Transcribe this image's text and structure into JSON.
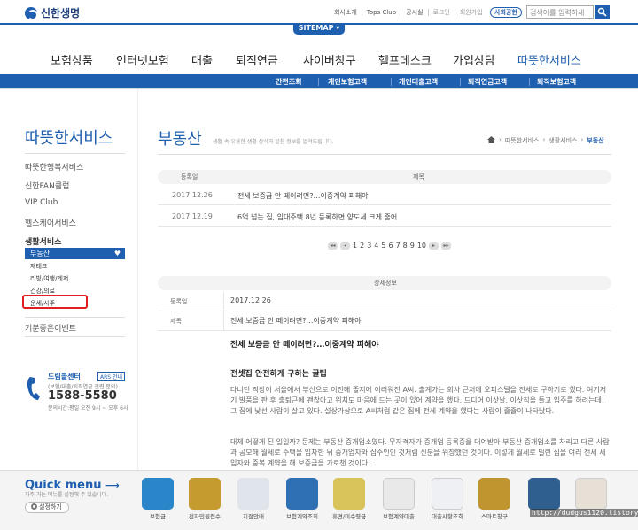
{
  "header": {
    "logo": "신한생명",
    "toplinks": [
      "회사소개",
      "Tops Club",
      "공시실",
      "로그인",
      "회원가입"
    ],
    "social_button": "사회공헌",
    "search_placeholder": "검색어를 입력하세",
    "sitemap": "SITEMAP ▾"
  },
  "gnb": [
    "보험상품",
    "인터넷보험",
    "대출",
    "퇴직연금",
    "사이버창구",
    "헬프데스크",
    "가입상담",
    "따뜻한서비스"
  ],
  "subnav": [
    "간편조회",
    "개인보험고객",
    "개인대출고객",
    "퇴직연금고객",
    "퇴직보험고객"
  ],
  "sidebar": {
    "title": "따뜻한서비스",
    "items": [
      "따뜻한행복서비스",
      "신한FAN클럽",
      "VIP Club",
      "헬스케어서비스"
    ],
    "group_label": "생활서비스",
    "active": "부동산",
    "sub_items": [
      "재테크",
      "리빙/여행/레저",
      "건강/의료",
      "운세/사주"
    ],
    "bottom_item": "기분좋은이벤트",
    "dream": {
      "title": "드림콜센터",
      "tag": "ARS 안내",
      "sub": "(보험/대출/퇴직연금 관련 문의)",
      "number": "1588-5580",
      "hours": "문의시간:평일 오전 9시 ~ 오후 6시"
    }
  },
  "page": {
    "title": "부동산",
    "desc": "생활 속 유용한 생활 상식과 알찬 정보를 알려드립니다.",
    "breadcrumb": [
      "따뜻한서비스",
      "생활서비스",
      "부동산"
    ]
  },
  "list": {
    "headers": [
      "등록일",
      "제목"
    ],
    "rows": [
      {
        "date": "2017.12.26",
        "subject": "전세 보증금 안 떼이려면?…이중계약 피해야"
      },
      {
        "date": "2017.12.19",
        "subject": "6억 넘는 집, 임대주택 8년 등록하면 양도세 크게 줄어"
      }
    ]
  },
  "pager": {
    "first": "◂◂",
    "prev": "◂",
    "pages": [
      "1",
      "2",
      "3",
      "4",
      "5",
      "6",
      "7",
      "8",
      "9",
      "10"
    ],
    "next": "▸",
    "last": "▸▸"
  },
  "detail": {
    "header": "상세정보",
    "date_label": "등록일",
    "date_value": "2017.12.26",
    "subject_label": "제목",
    "subject_value": "전세 보증금 안 떼이려면?…이중계약 피해야",
    "article_title": "전세 보증금 안 떼이려면?…이중계약 피해야",
    "article_sub": "전셋집 안전하게 구하는 꿀팁",
    "paragraphs": [
      "다니던 직장이 서울에서 부산으로 이전해 졸지에 이러워진 A씨. 출계가는 회사 근처에 오피스텔을 전세로 구하기로 했다. 여기저기 발품을 판 후 출퇴근에 괜찮아고 위치도 마음에 드는 곳이 있어 계약을 했다. 드디어 이삿날. 이삿짐을 들고 입주를 하려는데, 그 집에 낯선 사람이 살고 있다. 설상가상으로 A씨처럼 같은 집에 전세 계약을 했다는 사람이 줄줄이 나타났다.",
      "대체 어떻게 된 일일까? 문제는 부동산 중개업소였다. 무자격자가 중개업 등록증을 대여받아 부동산 중개업소를 차리고 다른 사람과 공모해 월세로 주택을 임차한 뒤 중개업자와 집주인인 것처럼 신분을 위장했던 것이다. 이렇게 월세로 빌린 집을 여러 전세 세입자와 중복 계약을 해 보증금을 가로챈 것이다."
    ]
  },
  "quick": {
    "title": "Quick menu",
    "desc": "자주 가는 메뉴를 설정해 주 있습니다.",
    "setting": "설정하기",
    "items": [
      {
        "label": "보험금",
        "color": "#2b86c9"
      },
      {
        "label": "전자민원접수",
        "color": "#c59a2e"
      },
      {
        "label": "지점안내",
        "color": "#dfe5ea"
      },
      {
        "label": "보험계약조회",
        "color": "#2f6fb3"
      },
      {
        "label": "휴면/미수령금",
        "color": "#d8c45a"
      },
      {
        "label": "보험계약대출",
        "color": "#e9e9e9"
      },
      {
        "label": "대출사항조회",
        "color": "#eef0f4"
      },
      {
        "label": "스마트창구",
        "color": "#c0942f"
      },
      {
        "label": "",
        "color": "#2f5f8f"
      },
      {
        "label": "",
        "color": "#e6e0d6"
      }
    ]
  },
  "watermark": "http://dudgus1120.tistory.com"
}
